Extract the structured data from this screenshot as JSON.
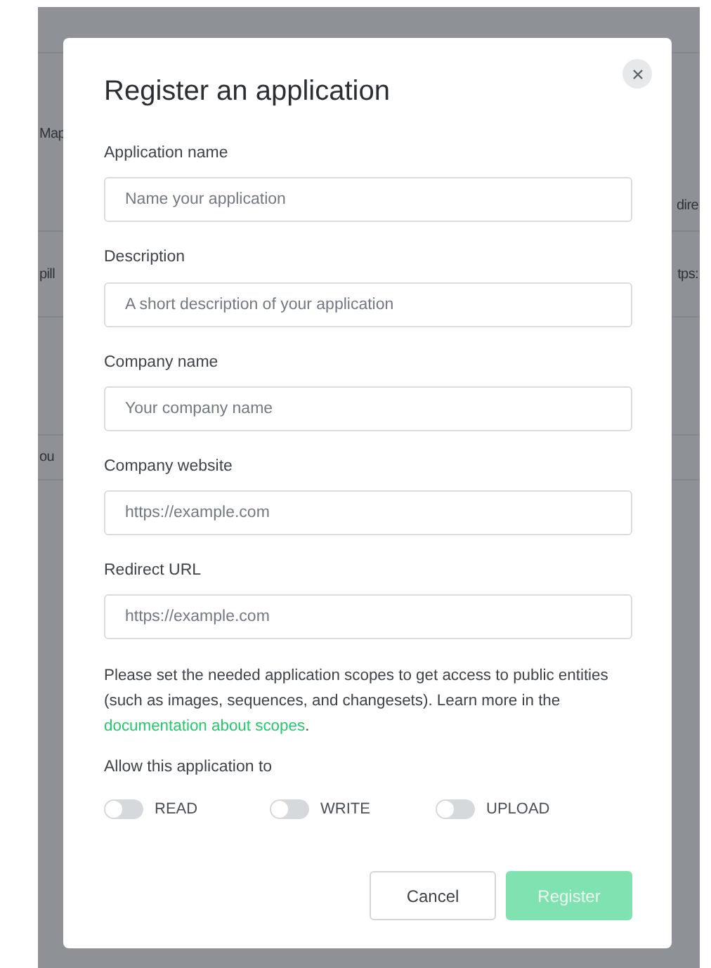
{
  "background": {
    "rows": [
      {
        "left": "",
        "right": ""
      },
      {
        "left": "Map",
        "right": "dire"
      },
      {
        "left": "pill",
        "right": "tps:"
      },
      {
        "left": "",
        "right": ""
      },
      {
        "left": "ou",
        "right": ""
      }
    ]
  },
  "modal": {
    "title": "Register an application",
    "fields": [
      {
        "label": "Application name",
        "placeholder": "Name your application"
      },
      {
        "label": "Description",
        "placeholder": "A short description of your application"
      },
      {
        "label": "Company name",
        "placeholder": "Your company name"
      },
      {
        "label": "Company website",
        "placeholder": "https://example.com"
      },
      {
        "label": "Redirect URL",
        "placeholder": "https://example.com"
      }
    ],
    "note": {
      "text": "Please set the needed application scopes to get access to public entities (such as images, sequences, and changesets). Learn more in the ",
      "link": "documentation about scopes",
      "after": "."
    },
    "permissions_label": "Allow this application to",
    "permissions": [
      {
        "label": "READ",
        "on": false
      },
      {
        "label": "WRITE",
        "on": false
      },
      {
        "label": "UPLOAD",
        "on": false
      }
    ],
    "buttons": [
      {
        "label": "Cancel",
        "kind": "secondary",
        "disabled": false
      },
      {
        "label": "Register",
        "kind": "primary",
        "disabled": true
      }
    ]
  }
}
